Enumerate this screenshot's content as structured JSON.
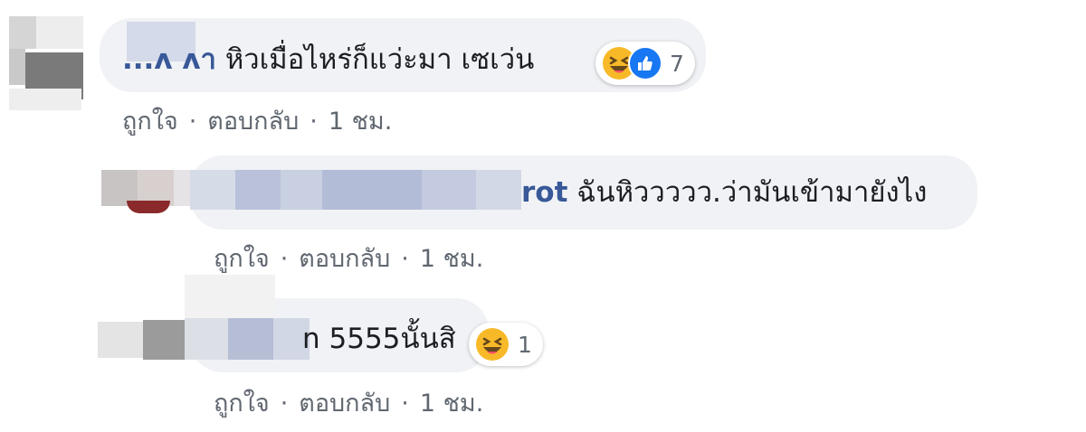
{
  "comments": [
    {
      "username": "...ᴧ ᴧา",
      "text": "หิวเมื่อไหร่ก็แว่ะมา เซเว่น",
      "reaction_icons": [
        "haha-icon",
        "like-icon"
      ],
      "reaction_count": "7",
      "like_label": "ถูกใจ",
      "reply_label": "ตอบกลับ",
      "time": "1 ชม."
    },
    {
      "username": "rot",
      "text": " ฉันหิววววว.ว่ามันเข้ามายังไง",
      "like_label": "ถูกใจ",
      "reply_label": "ตอบกลับ",
      "time": "1 ชม."
    },
    {
      "username": "",
      "text": "n 5555นั้นสิ",
      "reaction_icons": [
        "haha-icon"
      ],
      "reaction_count": "1",
      "like_label": "ถูกใจ",
      "reply_label": "ตอบกลับ",
      "time": "1 ชม."
    }
  ],
  "separator": "·",
  "colors": {
    "bubble": "#f0f2f5",
    "name": "#385898",
    "meta": "#606770",
    "like": "#1877f2",
    "haha": "#f7b928"
  }
}
